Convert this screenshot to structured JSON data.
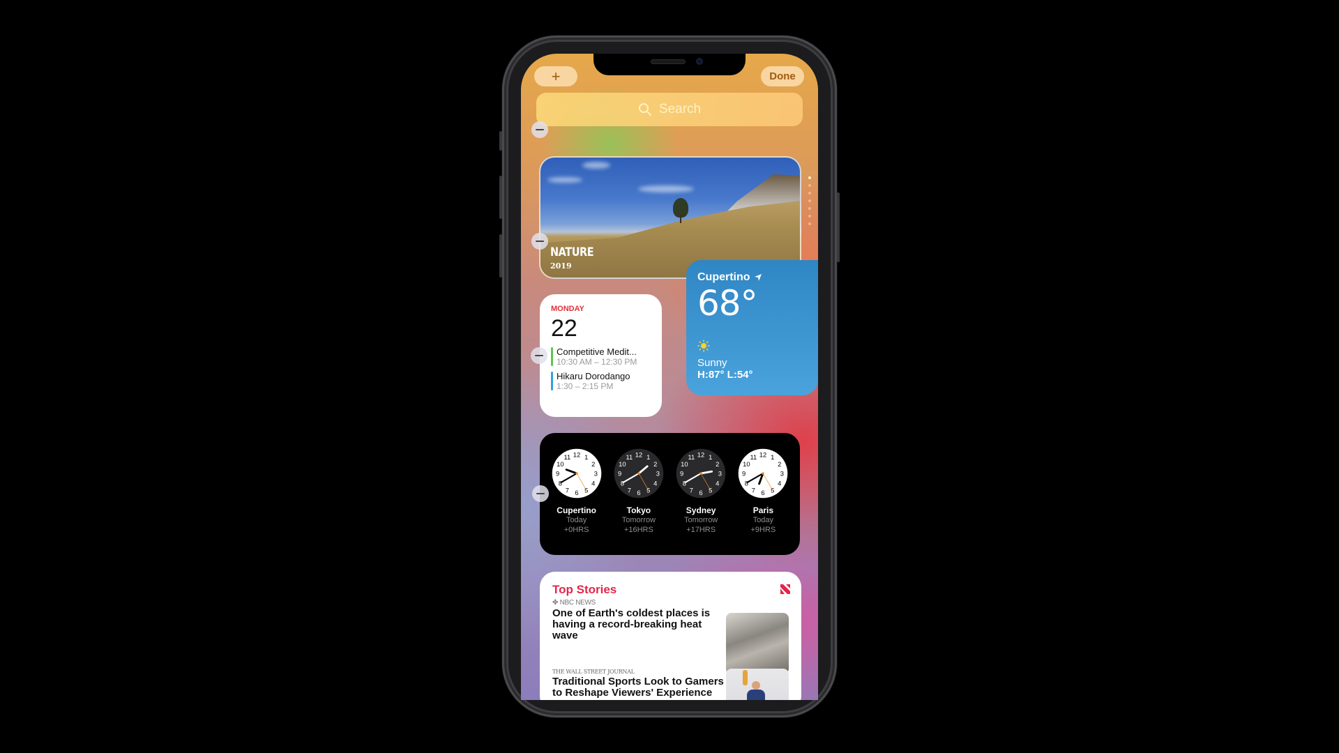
{
  "header": {
    "add_label": "+",
    "done_label": "Done"
  },
  "search": {
    "placeholder": "Search",
    "icon": "search-icon"
  },
  "photos_widget": {
    "title": "NATURE",
    "year": "2019",
    "page_count": 7,
    "active_page": 1
  },
  "calendar_widget": {
    "weekday": "MONDAY",
    "date": "22",
    "events": [
      {
        "title": "Competitive Medit...",
        "time": "10:30 AM – 12:30 PM",
        "color": "#5ac84a"
      },
      {
        "title": "Hikaru Dorodango",
        "time": "1:30 – 2:15 PM",
        "color": "#34a0dc"
      }
    ]
  },
  "weather_widget": {
    "city": "Cupertino",
    "temperature": "68°",
    "condition": "Sunny",
    "high_low": "H:87° L:54°",
    "location_icon": "location-arrow-icon",
    "condition_icon": "sun-icon"
  },
  "clock_widget": {
    "clocks": [
      {
        "city": "Cupertino",
        "day": "Today",
        "offset": "+0HRS",
        "theme": "light",
        "hour": 9,
        "minute": 40,
        "second": 25
      },
      {
        "city": "Tokyo",
        "day": "Tomorrow",
        "offset": "+16HRS",
        "theme": "dark",
        "hour": 1,
        "minute": 40,
        "second": 25
      },
      {
        "city": "Sydney",
        "day": "Tomorrow",
        "offset": "+17HRS",
        "theme": "dark",
        "hour": 2,
        "minute": 40,
        "second": 25
      },
      {
        "city": "Paris",
        "day": "Today",
        "offset": "+9HRS",
        "theme": "light",
        "hour": 6,
        "minute": 40,
        "second": 25
      }
    ]
  },
  "news_widget": {
    "heading": "Top Stories",
    "stories": [
      {
        "source": "NBC NEWS",
        "title": "One of Earth's coldest places is having a record-breaking heat wave"
      },
      {
        "source": "THE WALL STREET JOURNAL",
        "title": "Traditional Sports Look to Gamers to Reshape Viewers' Experience"
      }
    ]
  },
  "colors": {
    "accent_red": "#e3264a",
    "weather_blue": "#3a93d0",
    "button_text": "#a15a10"
  }
}
